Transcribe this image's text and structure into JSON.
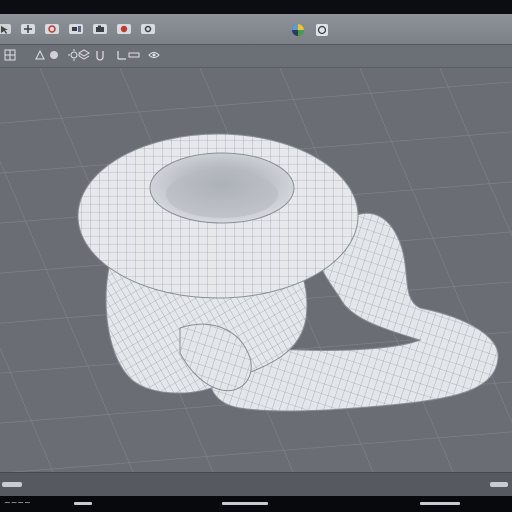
{
  "app": {
    "title": ""
  },
  "toolbar": {
    "buttons": [
      {
        "name": "select-tool-button",
        "icon": "cursor-icon"
      },
      {
        "name": "move-tool-button",
        "icon": "move-icon"
      },
      {
        "name": "rotate-tool-button",
        "icon": "rotate-icon"
      },
      {
        "name": "scale-tool-button",
        "icon": "scale-icon"
      },
      {
        "name": "camera-tool-button",
        "icon": "camera-icon"
      },
      {
        "name": "render-tool-button",
        "icon": "render-icon"
      },
      {
        "name": "settings-tool-button",
        "icon": "gear-icon"
      }
    ],
    "status_icons": [
      "palette-icon",
      "refresh-icon"
    ]
  },
  "subtoolbar": {
    "buttons": [
      "grid-icon",
      "wireframe-icon",
      "shaded-icon",
      "light-icon",
      "layers-icon",
      "snap-icon",
      "axis-icon",
      "measure-icon",
      "view-icon"
    ]
  },
  "viewport": {
    "mode": "wireframe",
    "object": "torus-tube-mesh",
    "colors": {
      "background": "#6a6e74",
      "grid": "#7d8188",
      "mesh_fill": "#e6e8ec",
      "mesh_line": "#8a8f98"
    }
  },
  "statusbar": {
    "left_text": "",
    "right_text": ""
  },
  "taskbar": {
    "corner_text": "~~~~"
  }
}
